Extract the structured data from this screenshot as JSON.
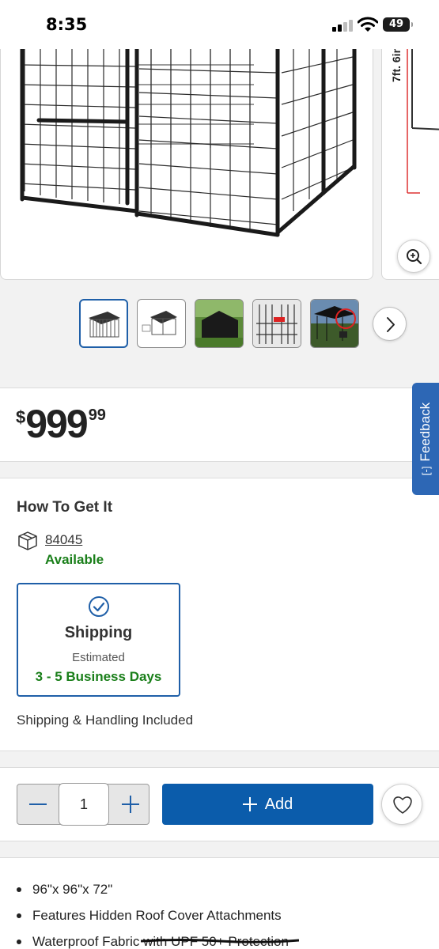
{
  "status_bar": {
    "time": "8:35",
    "battery": "49"
  },
  "gallery": {
    "next_image_label": "7ft. 6in",
    "thumbnails": [
      "thumbnail-1",
      "thumbnail-2",
      "thumbnail-3",
      "thumbnail-4",
      "thumbnail-5"
    ],
    "selected_index": 0
  },
  "price": {
    "currency": "$",
    "whole": "999",
    "cents": "99"
  },
  "feedback": {
    "label": "Feedback",
    "icon_text": "[-]"
  },
  "fulfillment": {
    "title": "How To Get It",
    "zip_code": "84045",
    "availability": "Available",
    "shipping_option": {
      "title": "Shipping",
      "estimated_label": "Estimated",
      "days": "3 - 5 Business Days"
    },
    "handling_note": "Shipping & Handling Included"
  },
  "cart": {
    "quantity": "1",
    "add_label": "Add"
  },
  "features": [
    "96\"x 96\"x 72\"",
    "Features Hidden Roof Cover Attachments",
    "Waterproof Fabric with UPF 50+ Protection"
  ],
  "icons": [
    "zoom-in-icon",
    "chevron-right-icon",
    "box-icon",
    "check-circle-icon",
    "minus-icon",
    "plus-icon",
    "heart-icon"
  ],
  "colors": {
    "accent": "#0b5cab",
    "available": "#1a7f1a",
    "feedback": "#2d67b5"
  }
}
